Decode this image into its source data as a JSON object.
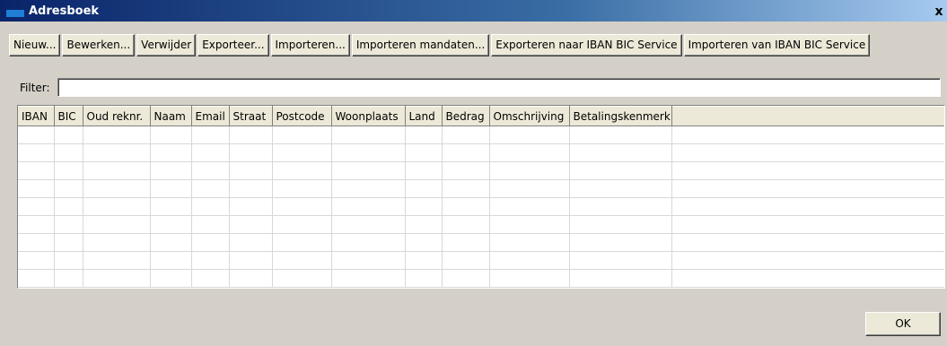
{
  "window": {
    "title": "Adresboek",
    "close_label": "x"
  },
  "toolbar": {
    "buttons": [
      {
        "label": "Nieuw..."
      },
      {
        "label": "Bewerken..."
      },
      {
        "label": "Verwijder"
      },
      {
        "label": "Exporteer..."
      },
      {
        "label": "Importeren..."
      },
      {
        "label": "Importeren mandaten..."
      },
      {
        "label": "Exporteren naar IBAN BIC Service"
      },
      {
        "label": "Importeren van IBAN BIC Service"
      }
    ]
  },
  "filter": {
    "label": "Filter:",
    "value": ""
  },
  "table": {
    "columns": [
      "IBAN",
      "BIC",
      "Oud reknr.",
      "Naam",
      "Email",
      "Straat",
      "Postcode",
      "Woonplaats",
      "Land",
      "Bedrag",
      "Omschrijving",
      "Betalingskenmerk"
    ]
  },
  "footer": {
    "ok_label": "OK"
  }
}
